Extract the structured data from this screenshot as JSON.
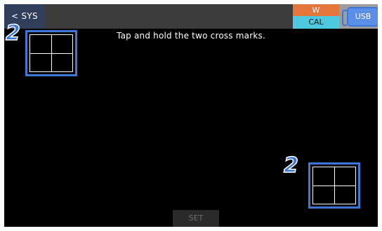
{
  "header": {
    "back_label": "< SYS",
    "mode_top": "W",
    "mode_bottom": "CAL",
    "usb_label": "USB"
  },
  "instruction": "Tap and hold the two cross marks.",
  "callouts": {
    "first": "2",
    "second": "2"
  },
  "footer": {
    "set_label": "SET"
  },
  "colors": {
    "background": "#000000",
    "topbar": "#3b3b3b",
    "back_button": "#2f3e5b",
    "mode_w": "#e5763b",
    "mode_cal": "#4fc9e0",
    "accent": "#3c78d8"
  }
}
